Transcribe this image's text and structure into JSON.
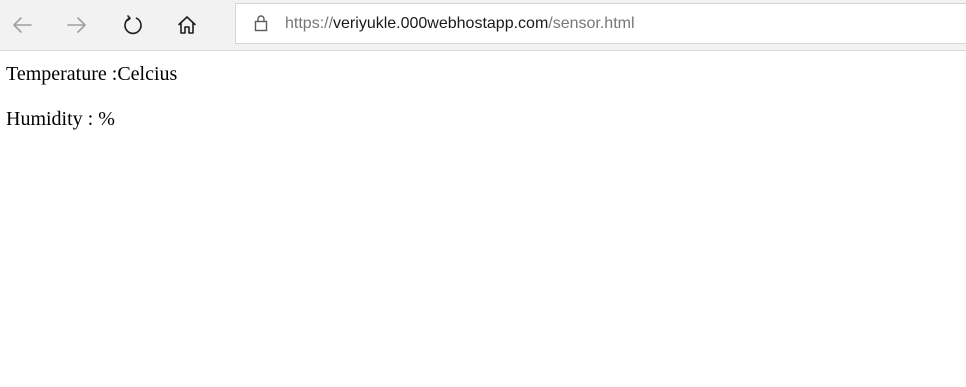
{
  "browser": {
    "nav": {
      "back_icon": "arrow-left-icon",
      "forward_icon": "arrow-right-icon",
      "refresh_icon": "refresh-icon",
      "home_icon": "home-icon"
    },
    "address": {
      "lock_icon": "lock-icon",
      "scheme": "https://",
      "host": "veriyukle.000webhostapp.com",
      "path": "/sensor.html"
    }
  },
  "page": {
    "temperature_line": "Temperature :Celcius",
    "humidity_line": "Humidity : %"
  },
  "colors": {
    "toolbar_bg": "#f2f2f2",
    "icon_disabled": "#a0a0a0",
    "icon_enabled": "#1f1f1f",
    "url_muted": "#767676"
  }
}
